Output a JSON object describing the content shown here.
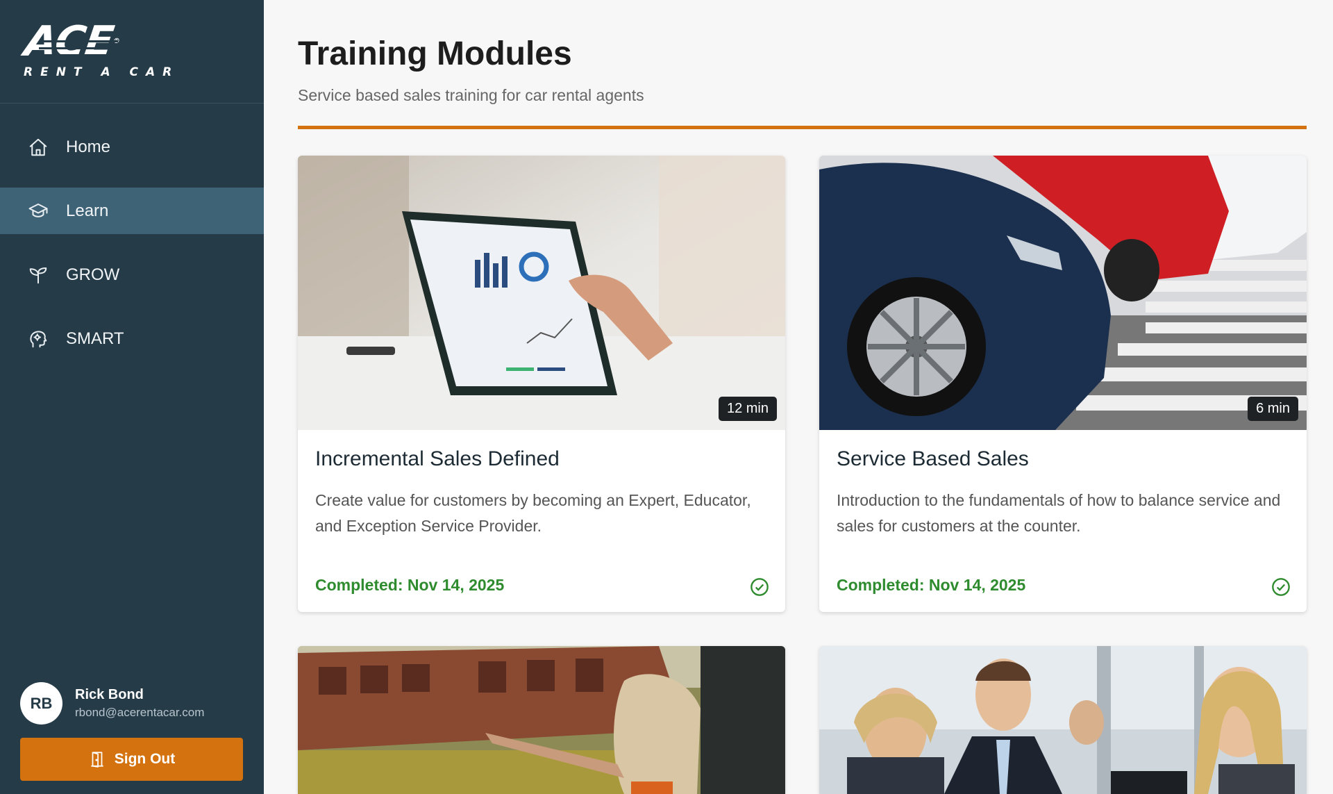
{
  "brand": {
    "logo_main": "ACE",
    "logo_reg": "®",
    "logo_sub": "RENT A CAR"
  },
  "sidebar": {
    "items": [
      {
        "label": "Home",
        "icon": "home-icon"
      },
      {
        "label": "Learn",
        "icon": "graduation-cap-icon",
        "active": true
      },
      {
        "label": "GROW",
        "icon": "sprout-icon"
      },
      {
        "label": "SMART",
        "icon": "brain-head-icon"
      }
    ],
    "user": {
      "initials": "RB",
      "name": "Rick Bond",
      "email": "rbond@acerentacar.com"
    },
    "signout_label": "Sign Out"
  },
  "main": {
    "title": "Training Modules",
    "subtitle": "Service based sales training for car rental agents",
    "cards": [
      {
        "duration": "12 min",
        "title": "Incremental Sales Defined",
        "description": "Create value for customers by becoming an Expert, Educator, and Exception Service Provider.",
        "status": "Completed: Nov 14, 2025"
      },
      {
        "duration": "6 min",
        "title": "Service Based Sales",
        "description": "Introduction to the fundamentals of how to balance service and sales for customers at the counter.",
        "status": "Completed: Nov 14, 2025"
      }
    ]
  },
  "colors": {
    "sidebar_bg": "#253b48",
    "active_item": "#3e6377",
    "accent": "#d4720f",
    "complete": "#2e8b2e"
  }
}
